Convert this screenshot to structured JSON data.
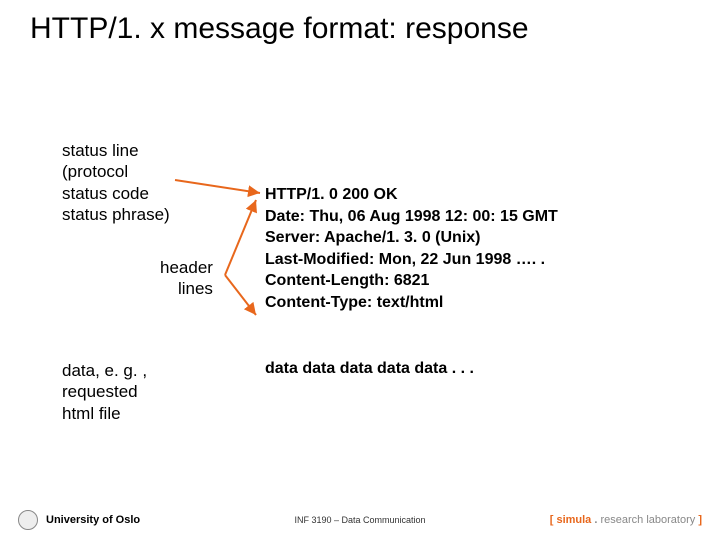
{
  "title": "HTTP/1. x message format: response",
  "labels": {
    "status": "status line\n(protocol\nstatus code\nstatus phrase)",
    "header": "header\nlines",
    "data": "data, e. g. ,\nrequested\nhtml file"
  },
  "message": {
    "line1": "HTTP/1. 0 200 OK",
    "line2": "Date: Thu, 06 Aug 1998 12: 00: 15 GMT",
    "line3": "Server: Apache/1. 3. 0 (Unix)",
    "line4": "Last-Modified: Mon, 22 Jun 1998 …. .",
    "line5": "Content-Length: 6821",
    "line6": "Content-Type: text/html"
  },
  "data_content": "data data data data data . . .",
  "footer": {
    "uio": "University of Oslo",
    "center": "INF 3190 – Data Communication",
    "simula_bracket_open": "[ ",
    "simula_name": "simula",
    "simula_dot": " . ",
    "simula_rest": "research laboratory",
    "simula_bracket_close": " ]"
  }
}
